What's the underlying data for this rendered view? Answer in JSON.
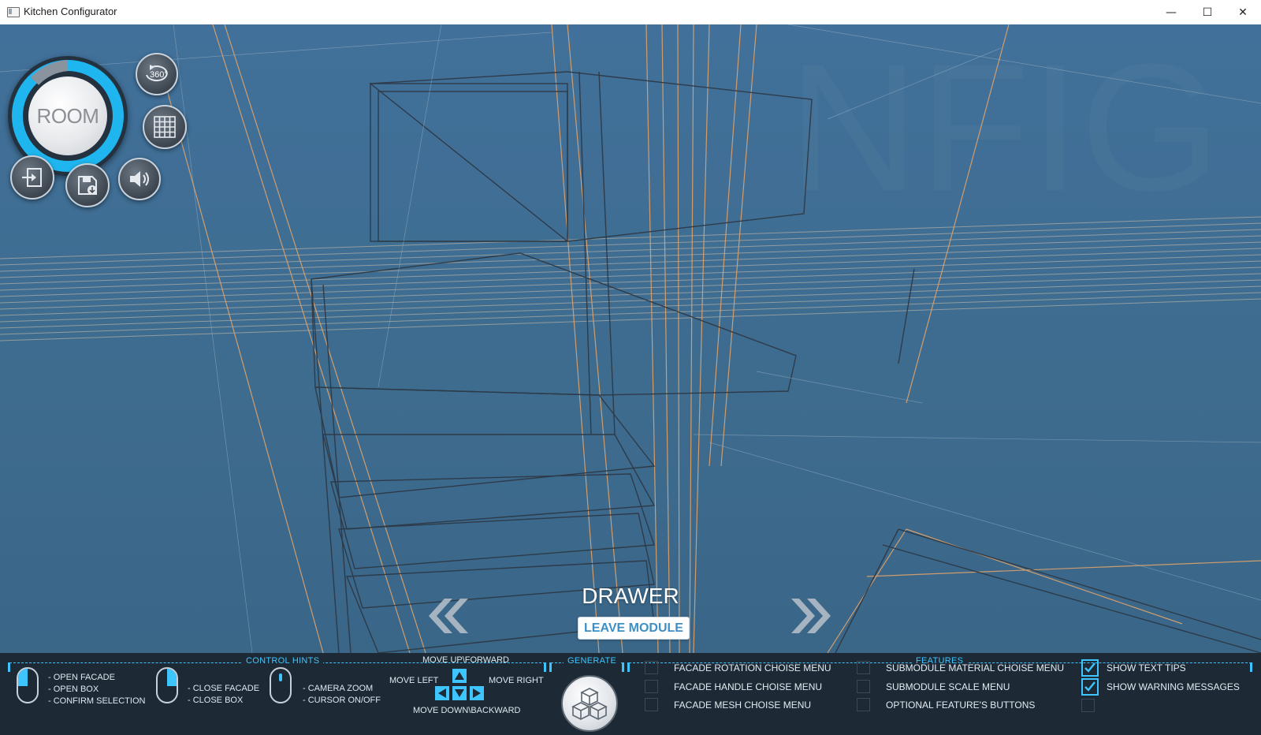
{
  "window": {
    "title": "Kitchen Configurator",
    "minimize_glyph": "—",
    "maximize_glyph": "☐",
    "close_glyph": "✕"
  },
  "toolbar": {
    "room_label": "ROOM",
    "rotate_360_label": "360°",
    "icons": [
      "rotate-360-icon",
      "grid-icon",
      "speaker-icon",
      "exit-icon",
      "save-icon"
    ]
  },
  "module": {
    "name": "DRAWER",
    "leave_label": "LEAVE MODULE",
    "prev_glyph": "«",
    "next_glyph": "»"
  },
  "control_hints": {
    "label": "CONTROL HINTS",
    "left_click": [
      "- OPEN FACADE",
      "- OPEN BOX",
      "- CONFIRM SELECTION"
    ],
    "right_click": [
      "- CLOSE FACADE",
      "- CLOSE BOX"
    ],
    "wheel": [
      "- CAMERA ZOOM",
      "- CURSOR ON/OFF"
    ],
    "move_up": "MOVE UP\\FORWARD",
    "move_left": "MOVE LEFT",
    "move_right": "MOVE RIGHT",
    "move_down": "MOVE DOWN\\BACKWARD"
  },
  "generate": {
    "label": "GENERATE"
  },
  "features": {
    "label": "FEATURES",
    "col1": [
      {
        "label": "FACADE ROTATION CHOISE MENU",
        "checked": false
      },
      {
        "label": "FACADE HANDLE CHOISE MENU",
        "checked": false
      },
      {
        "label": "FACADE MESH CHOISE MENU",
        "checked": false
      }
    ],
    "col2": [
      {
        "label": "SUBMODULE MATERIAL CHOISE MENU",
        "checked": false
      },
      {
        "label": "SUBMODULE SCALE MENU",
        "checked": false
      },
      {
        "label": "OPTIONAL FEATURE'S BUTTONS",
        "checked": false
      }
    ],
    "col3": [
      {
        "label": "SHOW TEXT TIPS",
        "checked": true
      },
      {
        "label": "SHOW WARNING MESSAGES",
        "checked": true
      },
      {
        "label": "",
        "checked": false
      }
    ]
  },
  "colors": {
    "accent": "#3ec5ff",
    "panel": "#1d2a36",
    "scene": "#3f6f92",
    "wire_dark": "#2b3541",
    "wire_orange": "#e0a36a"
  }
}
